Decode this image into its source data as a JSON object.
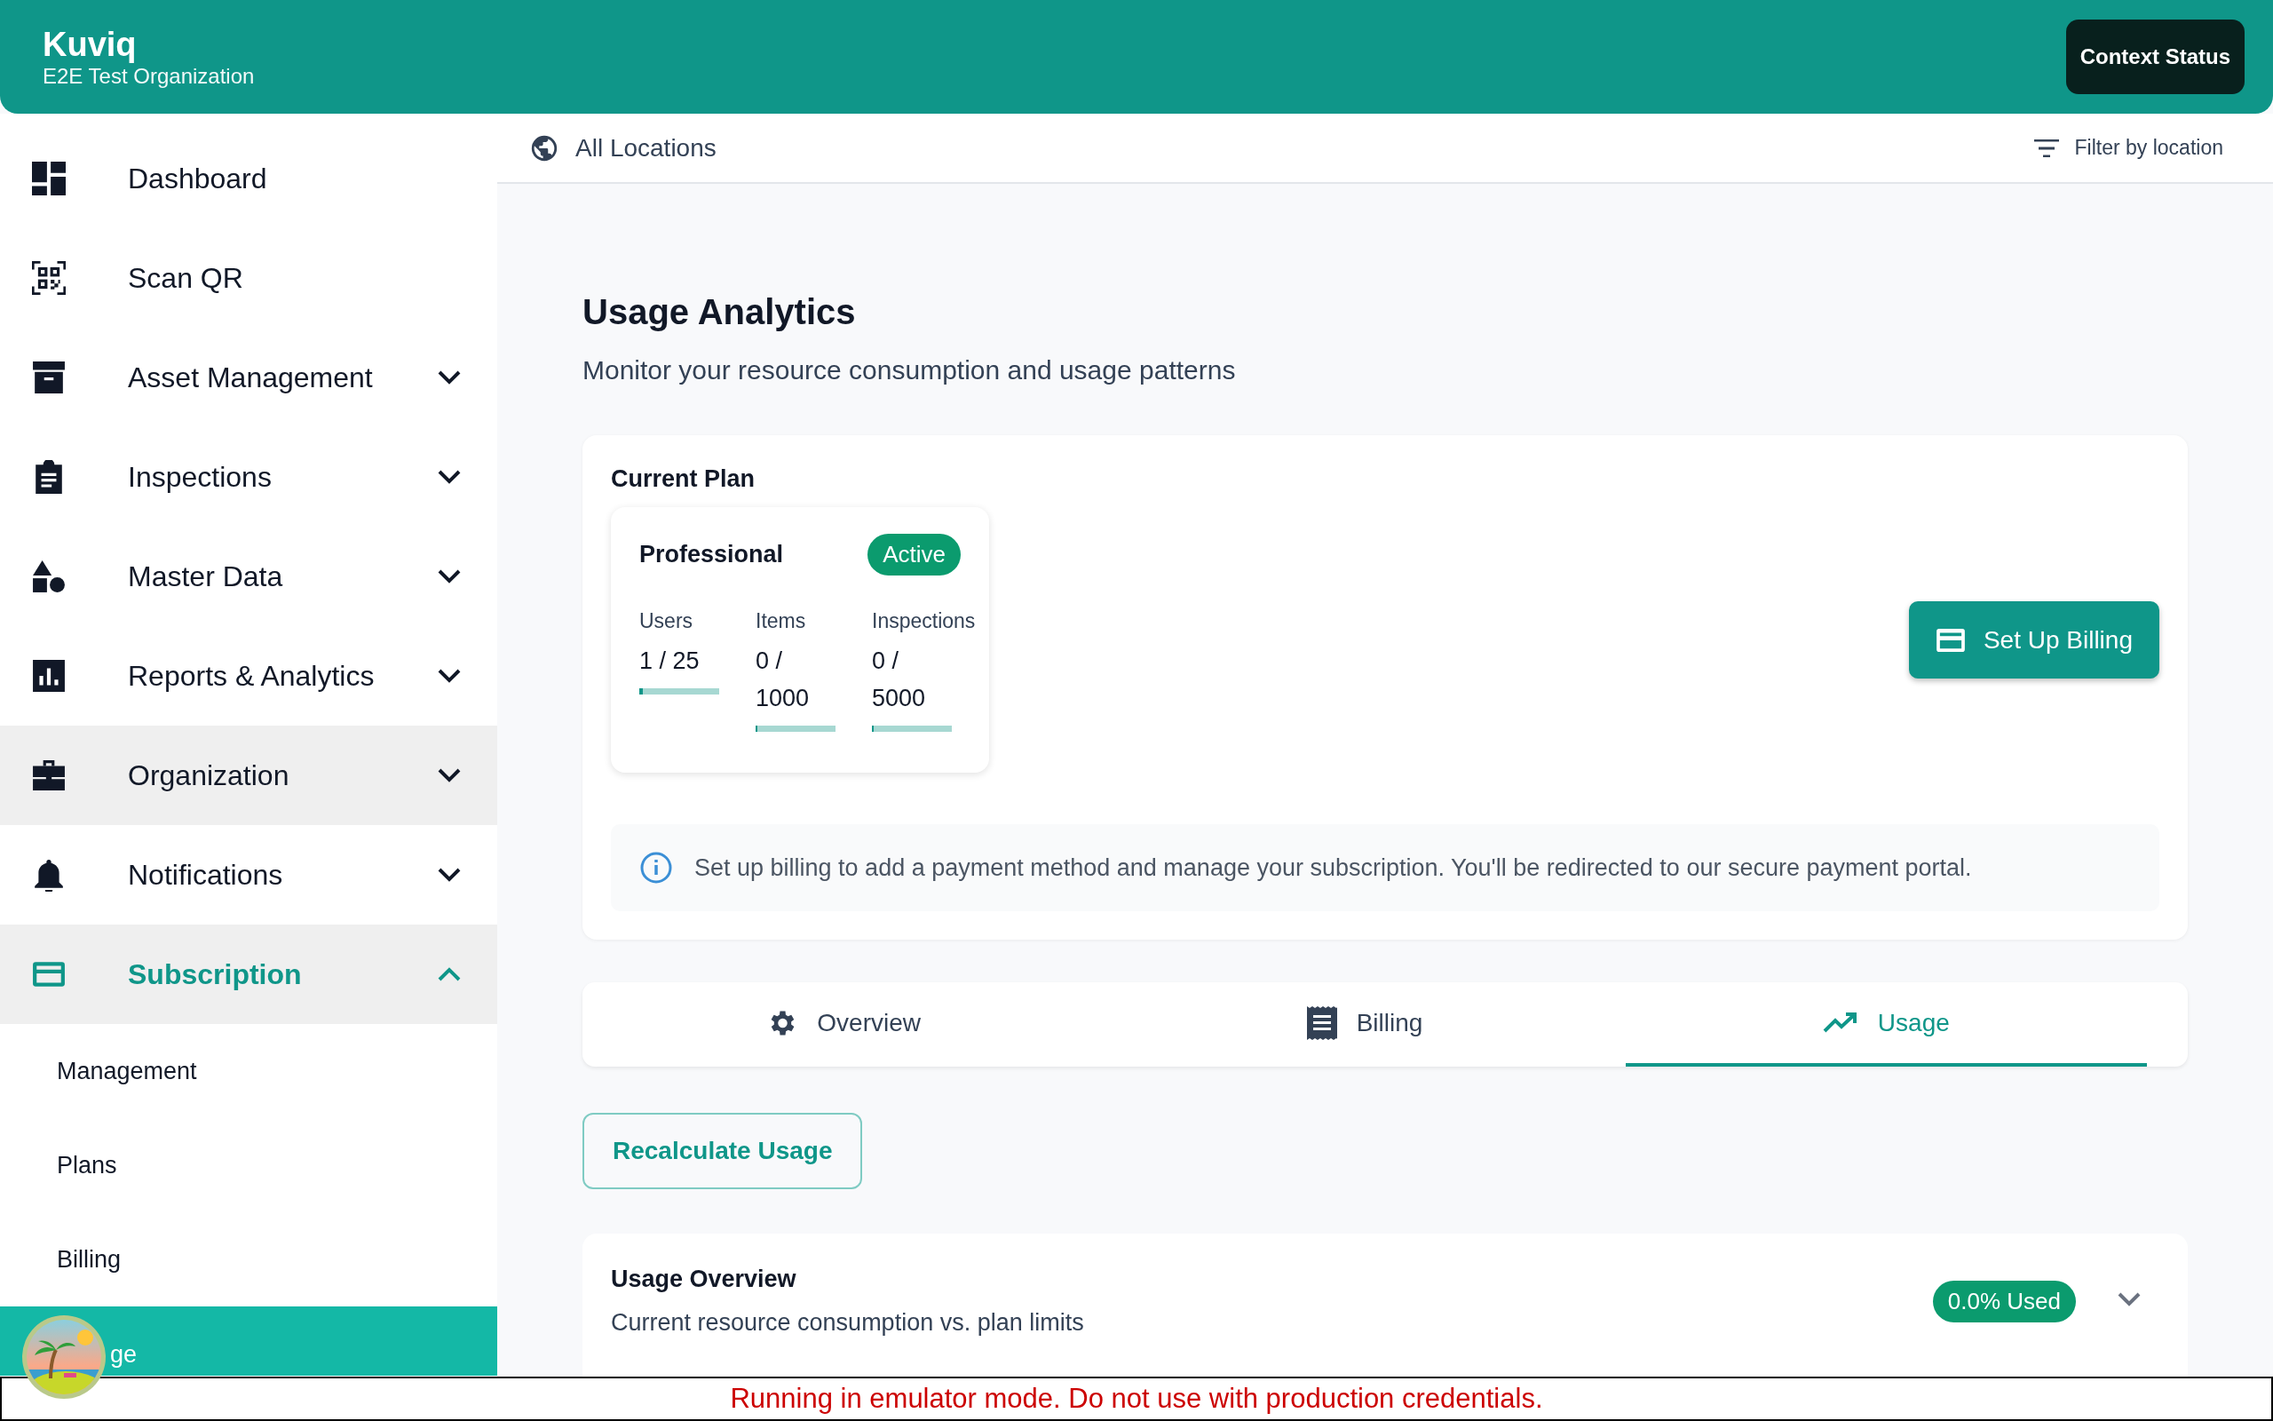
{
  "header": {
    "title": "Kuviq",
    "subtitle": "E2E Test Organization",
    "button": "Context Status"
  },
  "sidebar": {
    "items": [
      {
        "label": "Dashboard",
        "kind": "dashboard",
        "highlighted": false,
        "selected": false
      },
      {
        "label": "Scan QR",
        "kind": "qr",
        "highlighted": false,
        "selected": false
      },
      {
        "label": "Asset Management",
        "kind": "archive",
        "expandable": true,
        "highlighted": false,
        "selected": false
      },
      {
        "label": "Inspections",
        "kind": "clipboard",
        "expandable": true,
        "highlighted": false,
        "selected": false
      },
      {
        "label": "Master Data",
        "kind": "shapes",
        "expandable": true,
        "highlighted": false,
        "selected": false
      },
      {
        "label": "Reports & Analytics",
        "kind": "chart",
        "expandable": true,
        "highlighted": false,
        "selected": false
      },
      {
        "label": "Organization",
        "kind": "briefcase",
        "expandable": true,
        "highlighted": true,
        "selected": false
      },
      {
        "label": "Notifications",
        "kind": "bell",
        "expandable": true,
        "highlighted": false,
        "selected": false
      },
      {
        "label": "Subscription",
        "kind": "card",
        "expandable": true,
        "expanded": true,
        "highlighted": true,
        "selected": true,
        "children": [
          {
            "label": "Management",
            "selected": false
          },
          {
            "label": "Plans",
            "selected": false
          },
          {
            "label": "Billing",
            "selected": false
          },
          {
            "label": "ge",
            "selected": true
          }
        ]
      }
    ]
  },
  "location_bar": {
    "label": "All Locations",
    "filter": "Filter by location"
  },
  "page": {
    "title": "Usage Analytics",
    "subtitle": "Monitor your resource consumption and usage patterns"
  },
  "current_plan": {
    "heading": "Current Plan",
    "plan": {
      "name": "Professional",
      "status": "Active",
      "metrics": [
        {
          "label": "Users",
          "value": "1 / 25",
          "level": 0.04
        },
        {
          "label": "Items",
          "value": "0 / 1000",
          "level": 0
        },
        {
          "label": "Inspections",
          "value": "0 / 5000",
          "level": 0
        }
      ]
    },
    "button": "Set Up Billing",
    "info": "Set up billing to add a payment method and manage your subscription. You'll be redirected to our secure payment portal."
  },
  "tabs": [
    {
      "label": "Overview",
      "kind": "gear",
      "selected": false
    },
    {
      "label": "Billing",
      "kind": "receipt",
      "selected": false
    },
    {
      "label": "Usage",
      "kind": "trend",
      "selected": true
    }
  ],
  "recalculate_button": "Recalculate Usage",
  "usage_overview": {
    "title": "Usage Overview",
    "subtitle": "Current resource consumption vs. plan limits",
    "badge": "0.0% Used",
    "expanded": false
  },
  "banner": "Running in emulator mode. Do not use with production credentials."
}
